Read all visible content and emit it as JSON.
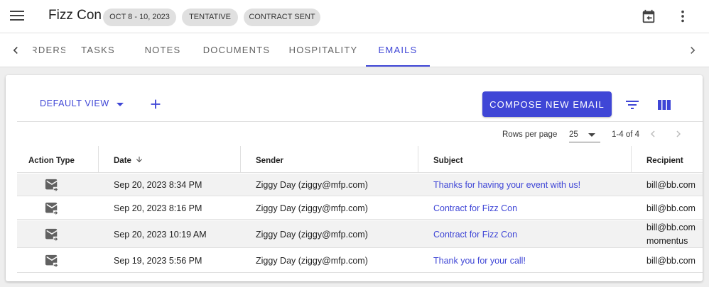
{
  "header": {
    "title": "Fizz Con",
    "chips": [
      "OCT 8 - 10, 2023",
      "TENTATIVE",
      "CONTRACT SENT"
    ]
  },
  "tabs": [
    {
      "label": "ORDERS"
    },
    {
      "label": "TASKS"
    },
    {
      "label": "NOTES"
    },
    {
      "label": "DOCUMENTS"
    },
    {
      "label": "HOSPITALITY"
    },
    {
      "label": "EMAILS",
      "active": true
    }
  ],
  "toolbar": {
    "view_label": "DEFAULT VIEW",
    "compose_label": "COMPOSE NEW EMAIL"
  },
  "pagination": {
    "rows_label": "Rows per page",
    "rows_value": "25",
    "range": "1-4 of 4"
  },
  "table": {
    "columns": [
      "Action Type",
      "Date",
      "Sender",
      "Subject",
      "Recipient"
    ],
    "rows": [
      {
        "date": "Sep 20, 2023 8:34 PM",
        "sender": "Ziggy Day (ziggy@mfp.com)",
        "subject": "Thanks for having your event with us!",
        "recipient": "bill@bb.com",
        "recipient2": ""
      },
      {
        "date": "Sep 20, 2023 8:16 PM",
        "sender": "Ziggy Day (ziggy@mfp.com)",
        "subject": "Contract for Fizz Con",
        "recipient": "bill@bb.com",
        "recipient2": ""
      },
      {
        "date": "Sep 20, 2023 10:19 AM",
        "sender": "Ziggy Day (ziggy@mfp.com)",
        "subject": "Contract for Fizz Con",
        "recipient": "bill@bb.com",
        "recipient2": "momentus"
      },
      {
        "date": "Sep 19, 2023 5:56 PM",
        "sender": "Ziggy Day (ziggy@mfp.com)",
        "subject": "Thank you for your call!",
        "recipient": "bill@bb.com",
        "recipient2": ""
      }
    ]
  },
  "colors": {
    "accent": "#3f46d6",
    "chip_bg": "#e0e0e0",
    "row_alt": "#f2f2f2"
  },
  "icons": {
    "menu": "menu-icon",
    "calendar": "calendar-return-icon",
    "more": "more-vertical-icon",
    "add": "plus-icon",
    "filter": "filter-icon",
    "columns": "columns-icon",
    "action_type": "email-forward-icon"
  }
}
